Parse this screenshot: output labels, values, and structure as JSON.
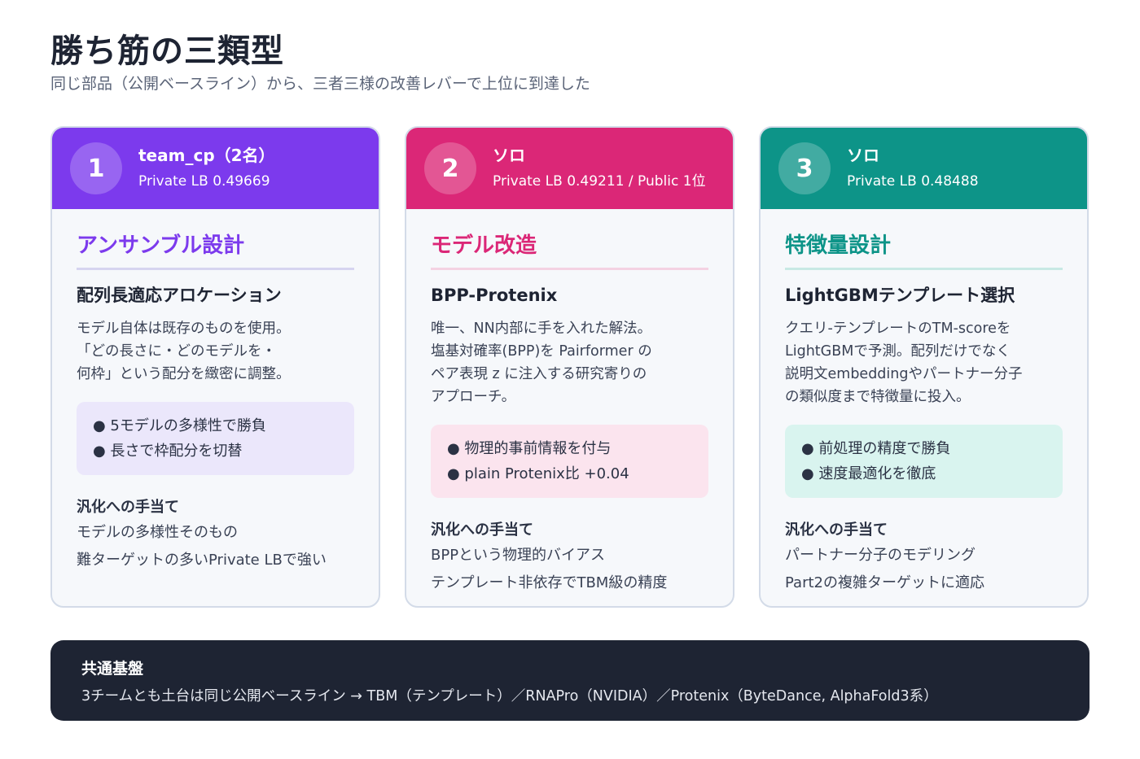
{
  "header": {
    "title": "勝ち筋の三類型",
    "subtitle": "同じ部品（公開ベースライン）から、三者三様の改善レバーで上位に到達した"
  },
  "cards": [
    {
      "number": "1",
      "team": "team_cp（2名）",
      "score": "Private LB 0.49669",
      "lever": "アンサンブル設計",
      "approach": "配列長適応アロケーション",
      "description": "モデル自体は既存のものを使用。\n「どの長さに・どのモデルを・\n何枠」という配分を緻密に調整。",
      "points": [
        "● 5モデルの多様性で勝負",
        "● 長さで枠配分を切替"
      ],
      "generalization_title": "汎化への手当て",
      "generalization": [
        "モデルの多様性そのもの",
        "難ターゲットの多いPrivate LBで強い"
      ],
      "color": "#7c3aed"
    },
    {
      "number": "2",
      "team": "ソロ",
      "score": "Private LB 0.49211 / Public 1位",
      "lever": "モデル改造",
      "approach": "BPP-Protenix",
      "description": "唯一、NN内部に手を入れた解法。\n塩基対確率(BPP)を Pairformer の\nペア表現 z に注入する研究寄りの\nアプローチ。",
      "points": [
        "● 物理的事前情報を付与",
        "● plain Protenix比 +0.04"
      ],
      "generalization_title": "汎化への手当て",
      "generalization": [
        "BPPという物理的バイアス",
        "テンプレート非依存でTBM級の精度"
      ],
      "color": "#db2777"
    },
    {
      "number": "3",
      "team": "ソロ",
      "score": "Private LB 0.48488",
      "lever": "特徴量設計",
      "approach": "LightGBMテンプレート選択",
      "description": "クエリ-テンプレートのTM-scoreを\nLightGBMで予測。配列だけでなく\n説明文embeddingやパートナー分子\nの類似度まで特徴量に投入。",
      "points": [
        "● 前処理の精度で勝負",
        "● 速度最適化を徹底"
      ],
      "generalization_title": "汎化への手当て",
      "generalization": [
        "パートナー分子のモデリング",
        "Part2の複雑ターゲットに適応"
      ],
      "color": "#0d9488"
    }
  ],
  "footer": {
    "title": "共通基盤",
    "text": "3チームとも土台は同じ公開ベースライン → TBM（テンプレート）／RNAPro（NVIDIA）／Protenix（ByteDance, AlphaFold3系）"
  }
}
